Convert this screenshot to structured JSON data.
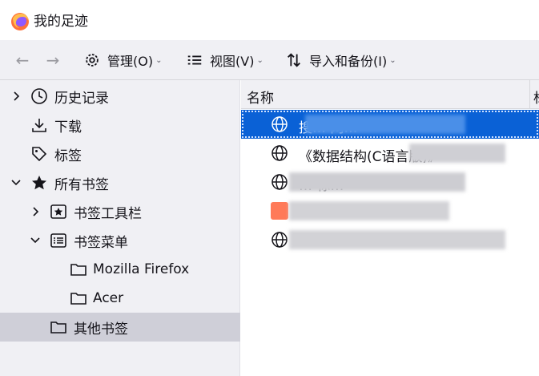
{
  "window": {
    "title": "我的足迹"
  },
  "toolbar": {
    "manage_label": "管理(O)",
    "view_label": "视图(V)",
    "import_backup_label": "导入和备份(I)"
  },
  "sidebar": {
    "items": [
      {
        "label": "历史记录",
        "icon": "clock-icon"
      },
      {
        "label": "下载",
        "icon": "download-icon"
      },
      {
        "label": "标签",
        "icon": "tag-icon"
      },
      {
        "label": "所有书签",
        "icon": "star-icon"
      },
      {
        "label": "书签工具栏",
        "icon": "star-box-icon"
      },
      {
        "label": "书签菜单",
        "icon": "list-icon"
      },
      {
        "label": "Mozilla Firefox",
        "icon": "folder-icon"
      },
      {
        "label": "Acer",
        "icon": "folder-icon"
      },
      {
        "label": "其他书签",
        "icon": "folder-icon"
      }
    ]
  },
  "list": {
    "header_name": "名称",
    "header_next": "标",
    "rows": [
      {
        "title": "搜… 网…"
      },
      {
        "title": "《数据结构(C语言版)》"
      },
      {
        "title": "… 标…"
      },
      {
        "title": "…"
      },
      {
        "title": "…"
      }
    ]
  },
  "colors": {
    "accent": "#0a61d6",
    "selected_bg": "#cfcfd8",
    "pane_bg": "#f0f0f4"
  }
}
